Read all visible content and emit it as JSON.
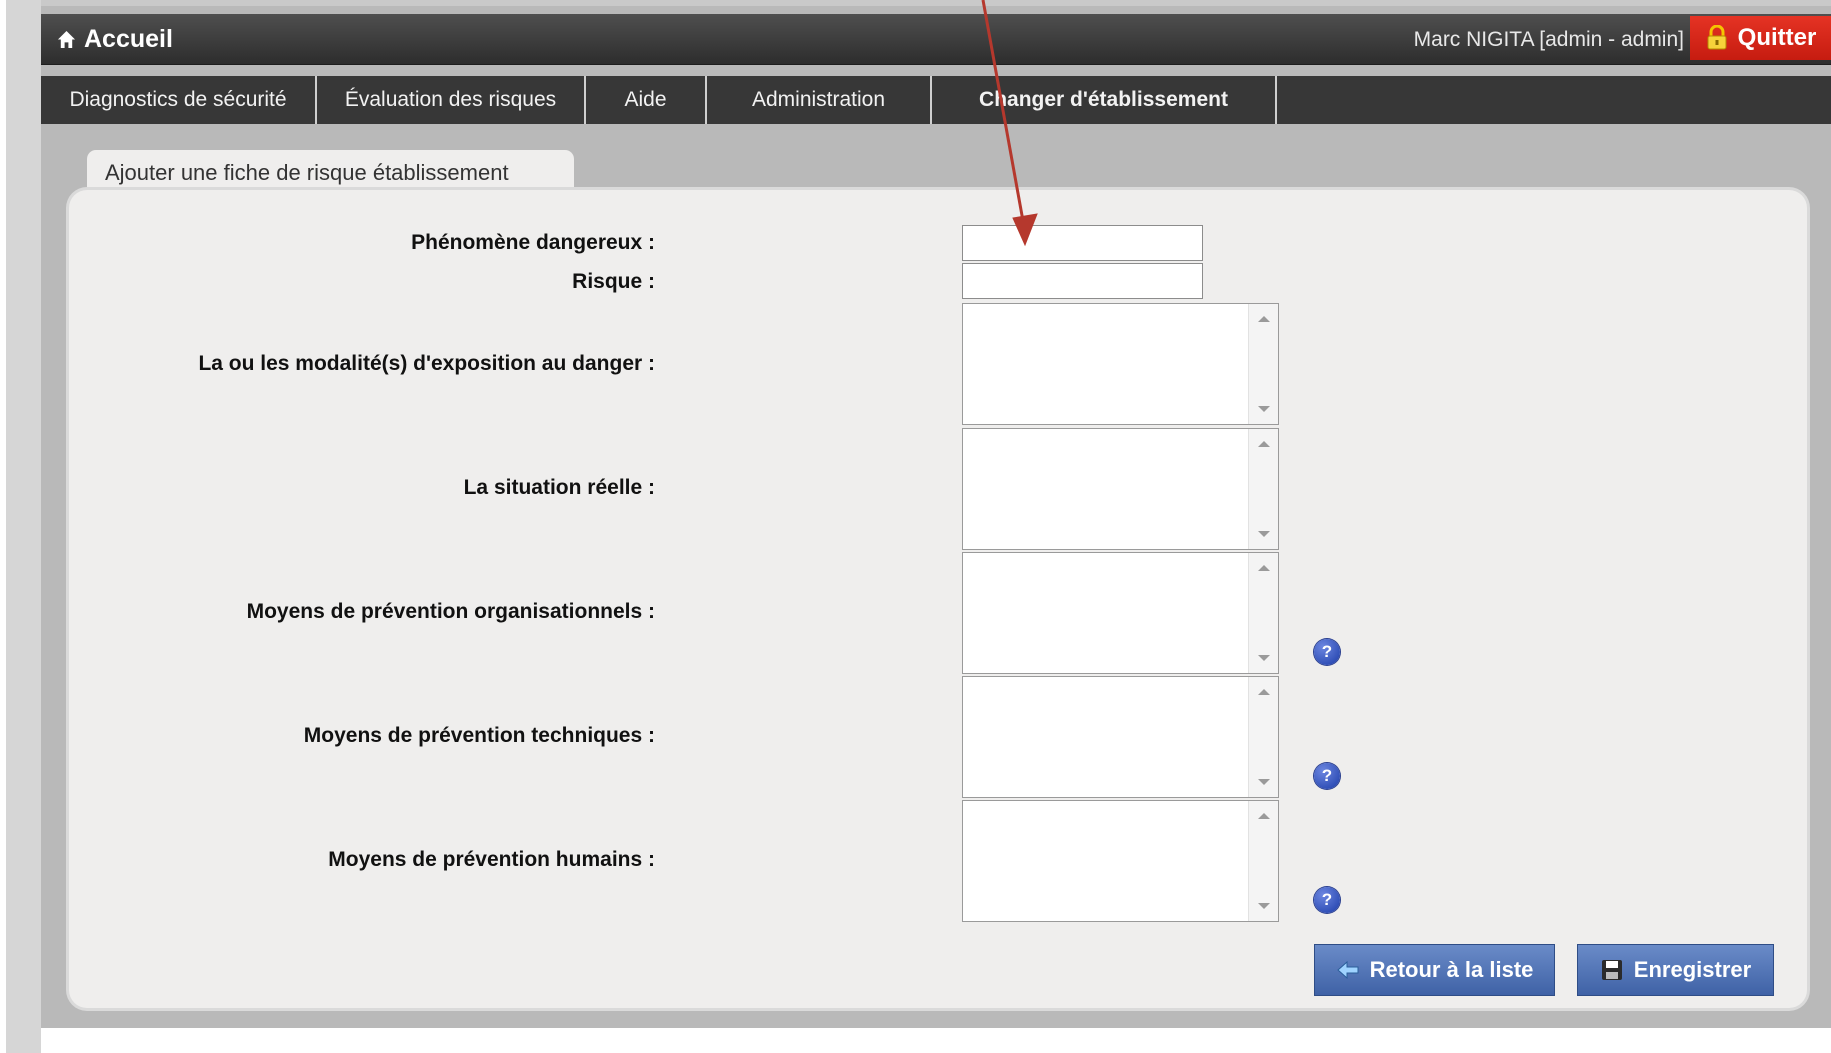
{
  "header": {
    "home_label": "Accueil",
    "user_info": "Marc NIGITA [admin - admin]",
    "quit_label": "Quitter"
  },
  "nav": {
    "items": [
      {
        "label": "Diagnostics de sécurité"
      },
      {
        "label": "Évaluation des risques"
      },
      {
        "label": "Aide"
      },
      {
        "label": "Administration"
      },
      {
        "label": "Changer d'établissement"
      }
    ]
  },
  "tab": {
    "label": "Ajouter une fiche de risque établissement"
  },
  "form": {
    "phenomene_label": "Phénomène dangereux :",
    "risque_label": "Risque :",
    "modalites_label": "La ou les modalité(s) d'exposition au danger :",
    "situation_label": "La situation réelle :",
    "prev_org_label": "Moyens de prévention organisationnels :",
    "prev_tech_label": "Moyens de prévention techniques :",
    "prev_hum_label": "Moyens de prévention humains :",
    "phenomene_value": "",
    "risque_value": ""
  },
  "help": {
    "glyph": "?"
  },
  "buttons": {
    "back_label": "Retour à la liste",
    "save_label": "Enregistrer"
  },
  "colors": {
    "header_dark": "#2d2d2d",
    "quit_red": "#d32719",
    "button_blue": "#4a6db0",
    "annotation_arrow": "#b5382d"
  }
}
